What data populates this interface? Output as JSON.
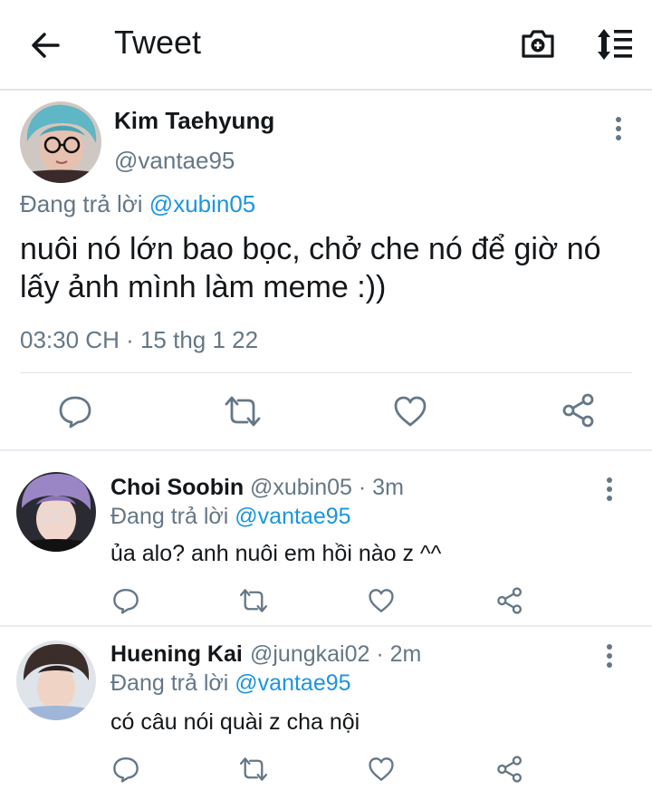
{
  "topbar": {
    "title": "Tweet"
  },
  "tweet": {
    "author_name": "Kim Taehyung",
    "author_handle": "@vantae95",
    "replying_prefix": "Đang trả lời",
    "replying_to": "@xubin05",
    "text": "nuôi nó lớn bao bọc, chở che nó để giờ nó lấy ảnh mình làm meme :))",
    "timestamp": "03:30 CH · 15 thg 1 22"
  },
  "replies": [
    {
      "name": "Choi Soobin",
      "handle": "@xubin05",
      "time": "· 3m",
      "replying_prefix": "Đang trả lời",
      "replying_to": "@vantae95",
      "text": "ủa alo? anh nuôi em hồi nào z ^^"
    },
    {
      "name": "Huening Kai",
      "handle": "@jungkai02",
      "time": "· 2m",
      "replying_prefix": "Đang trả lời",
      "replying_to": "@vantae95",
      "text": "có câu nói quài z cha nội"
    }
  ],
  "icons": {
    "back": "arrow-left-icon",
    "camera": "camera-plus-icon",
    "sort": "sort-list-icon",
    "reply": "speech-bubble-icon",
    "retweet": "retweet-icon",
    "like": "heart-icon",
    "share": "share-icon",
    "more": "more-vertical-icon"
  },
  "colors": {
    "link": "#1b95e0",
    "secondary": "#657786",
    "text": "#14171a",
    "icon": "#657786"
  }
}
